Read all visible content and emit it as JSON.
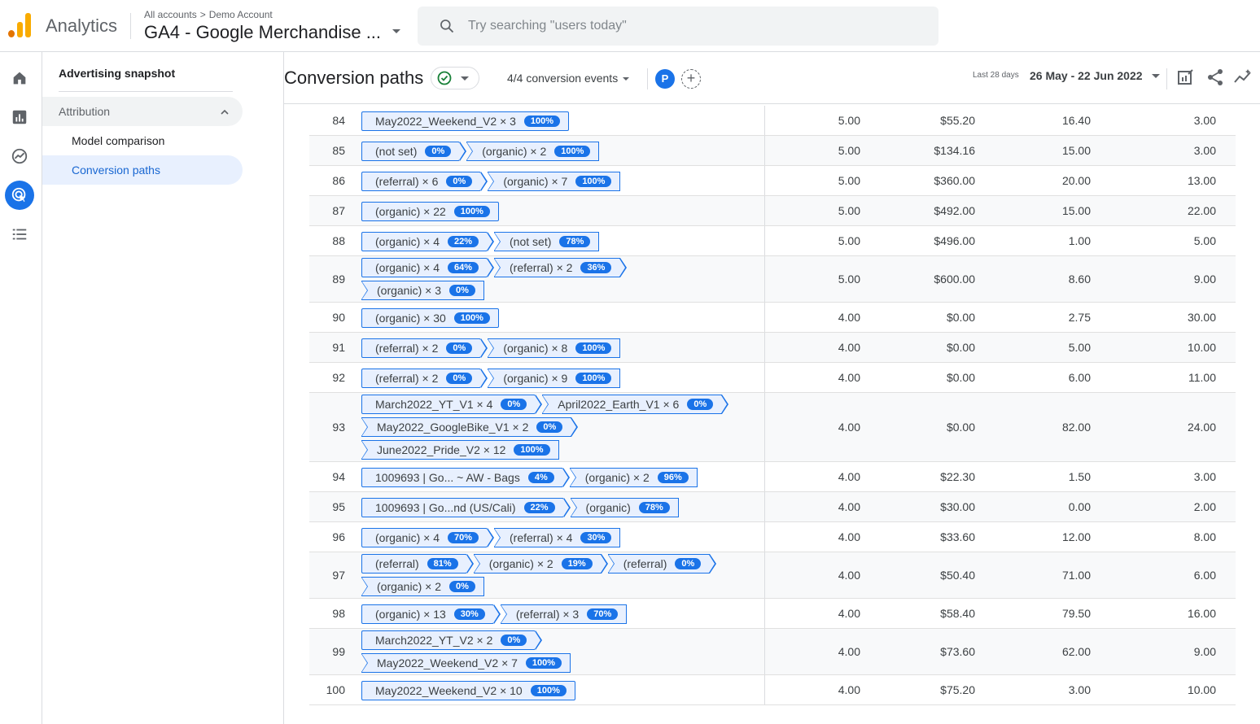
{
  "app": {
    "name": "Analytics"
  },
  "breadcrumb": {
    "all_accounts": "All accounts",
    "account": "Demo Account",
    "property": "GA4 - Google Merchandise ..."
  },
  "search": {
    "placeholder": "Try searching \"users today\""
  },
  "nav": {
    "top_item": "Advertising snapshot",
    "group": "Attribution",
    "items": [
      {
        "label": "Model comparison"
      },
      {
        "label": "Conversion paths"
      }
    ]
  },
  "header": {
    "title": "Conversion paths",
    "events": "4/4 conversion events",
    "avatar": "P",
    "date_label": "Last 28 days",
    "date_range": "26 May - 22 Jun 2022"
  },
  "colors": {
    "accent": "#1a73e8",
    "chip_bg": "#e8f0fe",
    "status_green": "#188038",
    "logo_orange": "#e37400",
    "logo_yellow": "#f9ab00"
  },
  "rows": [
    {
      "num": "84",
      "paths": [
        [
          {
            "label": "May2022_Weekend_V2 × 3",
            "pct": "100%"
          }
        ]
      ],
      "m": [
        "5.00",
        "$55.20",
        "16.40",
        "3.00"
      ]
    },
    {
      "num": "85",
      "paths": [
        [
          {
            "label": "(not set)",
            "pct": "0%"
          },
          {
            "label": "(organic) × 2",
            "pct": "100%"
          }
        ]
      ],
      "m": [
        "5.00",
        "$134.16",
        "15.00",
        "3.00"
      ]
    },
    {
      "num": "86",
      "paths": [
        [
          {
            "label": "(referral) × 6",
            "pct": "0%"
          },
          {
            "label": "(organic) × 7",
            "pct": "100%"
          }
        ]
      ],
      "m": [
        "5.00",
        "$360.00",
        "20.00",
        "13.00"
      ]
    },
    {
      "num": "87",
      "paths": [
        [
          {
            "label": "(organic) × 22",
            "pct": "100%"
          }
        ]
      ],
      "m": [
        "5.00",
        "$492.00",
        "15.00",
        "22.00"
      ]
    },
    {
      "num": "88",
      "paths": [
        [
          {
            "label": "(organic) × 4",
            "pct": "22%"
          },
          {
            "label": "(not set)",
            "pct": "78%"
          }
        ]
      ],
      "m": [
        "5.00",
        "$496.00",
        "1.00",
        "5.00"
      ]
    },
    {
      "num": "89",
      "paths": [
        [
          {
            "label": "(organic) × 4",
            "pct": "64%"
          },
          {
            "label": "(referral) × 2",
            "pct": "36%"
          }
        ],
        [
          {
            "label": "(organic) × 3",
            "pct": "0%"
          }
        ]
      ],
      "m": [
        "5.00",
        "$600.00",
        "8.60",
        "9.00"
      ]
    },
    {
      "num": "90",
      "paths": [
        [
          {
            "label": "(organic) × 30",
            "pct": "100%"
          }
        ]
      ],
      "m": [
        "4.00",
        "$0.00",
        "2.75",
        "30.00"
      ]
    },
    {
      "num": "91",
      "paths": [
        [
          {
            "label": "(referral) × 2",
            "pct": "0%"
          },
          {
            "label": "(organic) × 8",
            "pct": "100%"
          }
        ]
      ],
      "m": [
        "4.00",
        "$0.00",
        "5.00",
        "10.00"
      ]
    },
    {
      "num": "92",
      "paths": [
        [
          {
            "label": "(referral) × 2",
            "pct": "0%"
          },
          {
            "label": "(organic) × 9",
            "pct": "100%"
          }
        ]
      ],
      "m": [
        "4.00",
        "$0.00",
        "6.00",
        "11.00"
      ]
    },
    {
      "num": "93",
      "paths": [
        [
          {
            "label": "March2022_YT_V1 × 4",
            "pct": "0%"
          },
          {
            "label": "April2022_Earth_V1 × 6",
            "pct": "0%"
          }
        ],
        [
          {
            "label": "May2022_GoogleBike_V1 × 2",
            "pct": "0%"
          }
        ],
        [
          {
            "label": "June2022_Pride_V2 × 12",
            "pct": "100%"
          }
        ]
      ],
      "m": [
        "4.00",
        "$0.00",
        "82.00",
        "24.00"
      ]
    },
    {
      "num": "94",
      "paths": [
        [
          {
            "label": "1009693 | Go... ~ AW - Bags",
            "pct": "4%"
          },
          {
            "label": "(organic) × 2",
            "pct": "96%"
          }
        ]
      ],
      "m": [
        "4.00",
        "$22.30",
        "1.50",
        "3.00"
      ]
    },
    {
      "num": "95",
      "paths": [
        [
          {
            "label": "1009693 | Go...nd (US/Cali)",
            "pct": "22%"
          },
          {
            "label": "(organic)",
            "pct": "78%"
          }
        ]
      ],
      "m": [
        "4.00",
        "$30.00",
        "0.00",
        "2.00"
      ]
    },
    {
      "num": "96",
      "paths": [
        [
          {
            "label": "(organic) × 4",
            "pct": "70%"
          },
          {
            "label": "(referral) × 4",
            "pct": "30%"
          }
        ]
      ],
      "m": [
        "4.00",
        "$33.60",
        "12.00",
        "8.00"
      ]
    },
    {
      "num": "97",
      "paths": [
        [
          {
            "label": "(referral)",
            "pct": "81%"
          },
          {
            "label": "(organic) × 2",
            "pct": "19%"
          },
          {
            "label": "(referral)",
            "pct": "0%"
          }
        ],
        [
          {
            "label": "(organic) × 2",
            "pct": "0%"
          }
        ]
      ],
      "m": [
        "4.00",
        "$50.40",
        "71.00",
        "6.00"
      ]
    },
    {
      "num": "98",
      "paths": [
        [
          {
            "label": "(organic) × 13",
            "pct": "30%"
          },
          {
            "label": "(referral) × 3",
            "pct": "70%"
          }
        ]
      ],
      "m": [
        "4.00",
        "$58.40",
        "79.50",
        "16.00"
      ]
    },
    {
      "num": "99",
      "paths": [
        [
          {
            "label": "March2022_YT_V2 × 2",
            "pct": "0%"
          }
        ],
        [
          {
            "label": "May2022_Weekend_V2 × 7",
            "pct": "100%"
          }
        ]
      ],
      "m": [
        "4.00",
        "$73.60",
        "62.00",
        "9.00"
      ]
    },
    {
      "num": "100",
      "paths": [
        [
          {
            "label": "May2022_Weekend_V2 × 10",
            "pct": "100%"
          }
        ]
      ],
      "m": [
        "4.00",
        "$75.20",
        "3.00",
        "10.00"
      ]
    }
  ]
}
